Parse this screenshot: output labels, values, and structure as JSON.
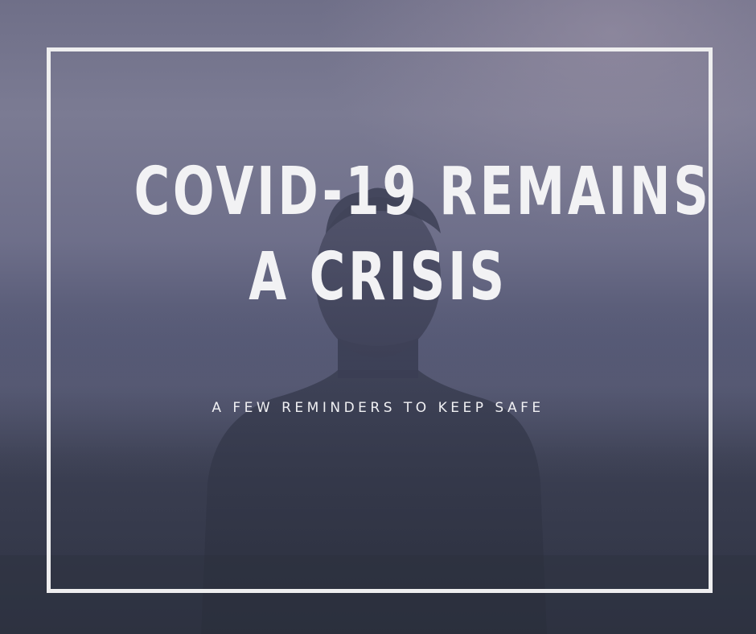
{
  "poster": {
    "headline_line1": "COVID-19 REMAINS",
    "headline_line2": "A CRISIS",
    "subtitle": "A FEW REMINDERS TO KEEP SAFE"
  },
  "colors": {
    "text": "#f2f2f4",
    "frame": "#eeeeef",
    "sky_top": "#7b7b93",
    "ground": "#2f3343"
  }
}
